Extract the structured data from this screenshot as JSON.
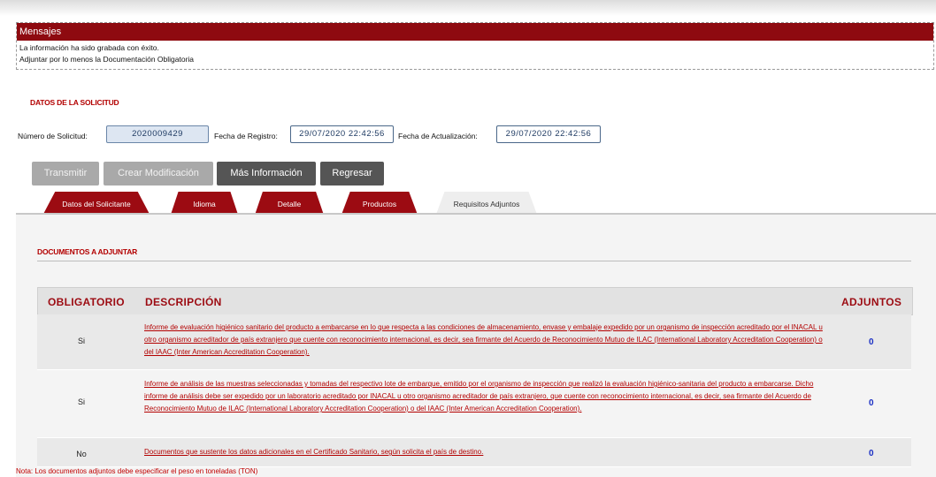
{
  "mensajes": {
    "title": "Mensajes",
    "lines": [
      "La información ha sido grabada con éxito.",
      "Adjuntar por lo menos la Documentación Obligatoria"
    ]
  },
  "solicitud": {
    "section_title": "DATOS DE LA SOLICITUD",
    "numero_label": "Número de Solicitud:",
    "numero_value": "2020009429",
    "fecha_registro_label": "Fecha de Registro:",
    "fecha_registro_value": "29/07/2020 22:42:56",
    "fecha_actualizacion_label": "Fecha de Actualización:",
    "fecha_actualizacion_value": "29/07/2020 22:42:56"
  },
  "buttons": {
    "transmitir": "Transmitir",
    "crear_modificacion": "Crear Modificación",
    "mas_informacion": "Más Información",
    "regresar": "Regresar"
  },
  "tabs": [
    {
      "label": "Datos del Solicitante"
    },
    {
      "label": "Idioma"
    },
    {
      "label": "Detalle"
    },
    {
      "label": "Productos"
    },
    {
      "label": "Requisitos Adjuntos"
    }
  ],
  "documentos": {
    "section_title": "DOCUMENTOS A ADJUNTAR",
    "headers": {
      "obligatorio": "OBLIGATORIO",
      "descripcion": "DESCRIPCIÓN",
      "adjuntos": "ADJUNTOS"
    },
    "rows": [
      {
        "obligatorio": "Si",
        "descripcion": "Informe de evaluación higiénico sanitario del producto a embarcarse en lo que respecta a las condiciones de almacenamiento, envase y embalaje expedido por un organismo de inspección acreditado por el INACAL u otro organismo acreditador de país extranjero que cuente con reconocimiento internacional, es decir, sea firmante del Acuerdo de Reconocimiento Mutuo de ILAC (International Laboratory Accreditation Cooperation) o del IAAC (Inter American Accreditation Cooperation).",
        "adjuntos": "0"
      },
      {
        "obligatorio": "Si",
        "descripcion": "Informe de análisis de las muestras seleccionadas y tomadas del respectivo lote de embarque, emitido por el organismo de inspección que realizó la evaluación higiénico-sanitaria del producto a embarcarse. Dicho informe de análisis debe ser expedido por un laboratorio acreditado por INACAL u otro organismo acreditador de país extranjero, que cuente con reconocimiento internacional, es decir, sea firmante del Acuerdo de Reconocimiento Mutuo de ILAC (International Laboratory Accreditation Cooperation) o del IAAC (Inter American Accreditation Cooperation).",
        "adjuntos": "0"
      },
      {
        "obligatorio": "No",
        "descripcion": "Documentos que sustente los datos adicionales en el Certificado Sanitario, según solicita el país de destino.",
        "adjuntos": "0"
      }
    ]
  },
  "note": "Nota: Los documentos adjuntos debe especificar el peso en toneladas (TON)",
  "colors": {
    "brand_red": "#9c0b12",
    "link_red": "#b30000",
    "adjuntos_blue": "#1a2fc4"
  }
}
